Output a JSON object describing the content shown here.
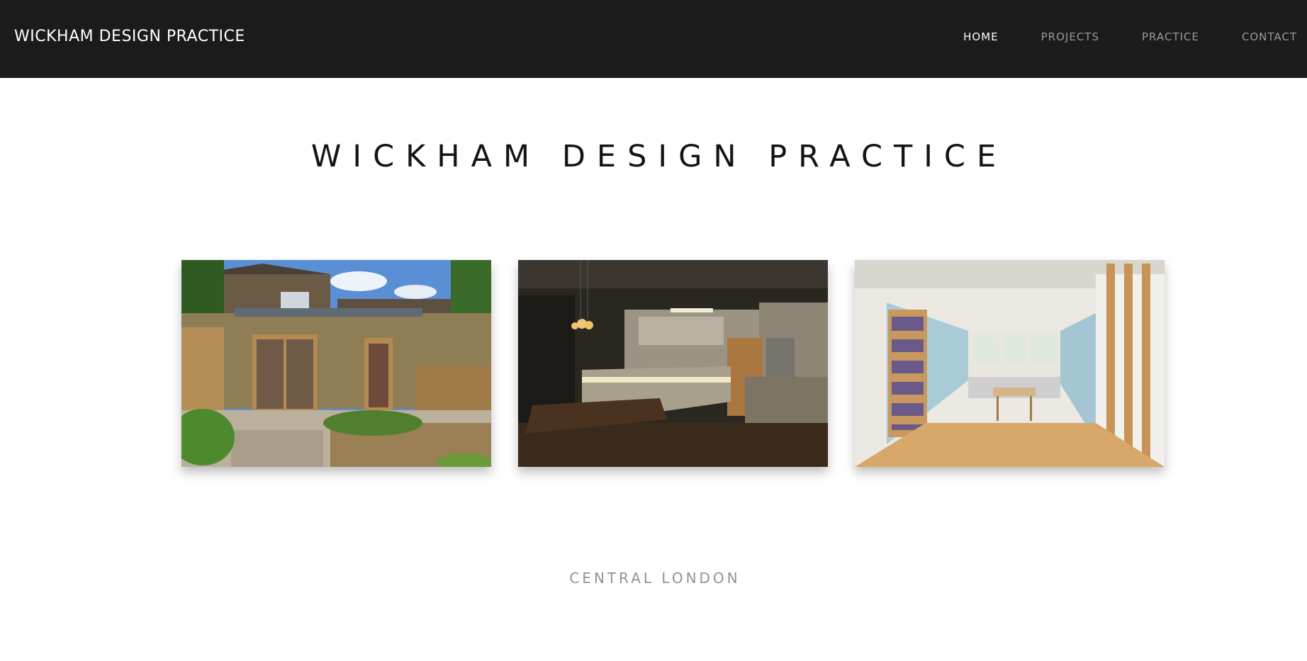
{
  "header": {
    "brand": "WICKHAM DESIGN PRACTICE",
    "nav": [
      {
        "label": "HOME",
        "active": true
      },
      {
        "label": "PROJECTS",
        "active": false
      },
      {
        "label": "PRACTICE",
        "active": false
      },
      {
        "label": "CONTACT",
        "active": false
      }
    ]
  },
  "main": {
    "title": "WICKHAM DESIGN PRACTICE",
    "location": "CENTRAL LONDON"
  },
  "colors": {
    "header_bg": "#1b1b1b",
    "nav_active": "#ffffff",
    "nav_inactive": "#9a9a9a",
    "title": "#141414",
    "location": "#8e9396"
  }
}
